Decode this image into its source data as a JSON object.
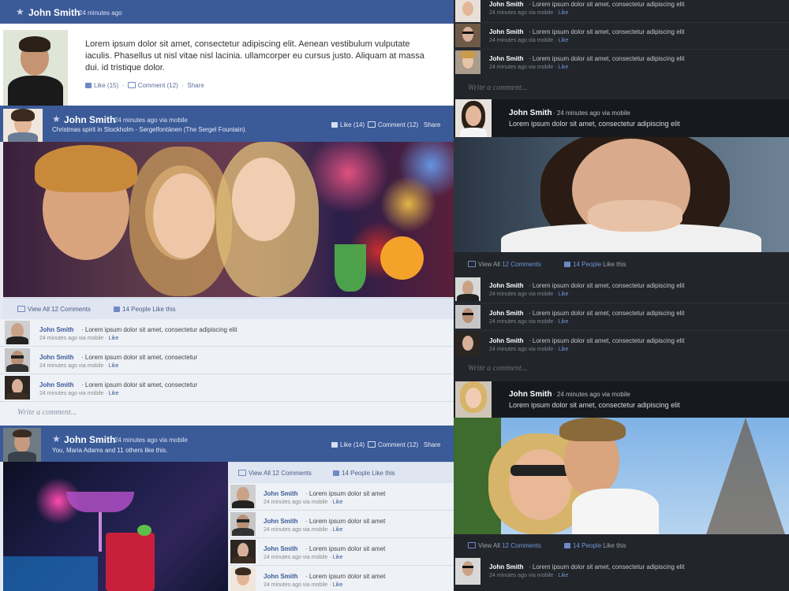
{
  "colors": {
    "facebook_blue": "#3b5a98",
    "dark_bg": "#22262b",
    "link_blue": "#6f95d9"
  },
  "icons": {
    "star": "★",
    "like": "thumbs-up-icon",
    "comment": "comment-icon"
  },
  "post1": {
    "author": "John Smith",
    "time": "24 minutes ago",
    "body_lines": [
      "Lorem ipsum dolor sit amet, consectetur adipiscing elit. Aenean vestibulum vulputate",
      "iaculis. Phasellus ut nisl vitae nisl lacinia. ullamcorper eu cursus justo. Aliquam at massa",
      "dui. id tristique dolor."
    ],
    "like": "Like (15)",
    "comment": "Comment (12)",
    "share": "Share"
  },
  "post2": {
    "author": "John Smith",
    "time": "24 minutes ago via mobile",
    "caption": "Christmas spirit in Stockholm - Sergelfontänen (The Sergel Fountain).",
    "like": "Like (14)",
    "comment": "Comment (12)",
    "share": "Share",
    "view_comments": "View All 12 Comments",
    "people_like": "14 People Like this",
    "comments": [
      {
        "name": "John Smith",
        "text": "· Lorem ipsum dolor sit amet, consectetur adipiscing elit",
        "meta": "24 minutes ago via mobile ·",
        "like": "Like"
      },
      {
        "name": "John Smith",
        "text": "· Lorem ipsum dolor sit amet, consectetur",
        "meta": "24 minutes ago via mobile ·",
        "like": "Like"
      },
      {
        "name": "John Smith",
        "text": "· Lorem ipsum dolor sit amet, consectetur",
        "meta": "24 minutes ago via mobile ·",
        "like": "Like"
      }
    ],
    "write_comment": "Write a comment..."
  },
  "post3": {
    "author": "John Smith",
    "time": "24 minutes ago via mobile",
    "caption": "You, Maria Adams and 11 others like this.",
    "like": "Like (14)",
    "comment": "Comment (12)",
    "share": "Share",
    "view_comments": "View All 12 Comments",
    "people_like": "14 People Like this",
    "comments": [
      {
        "name": "John Smith",
        "text": "· Lorem ipsum dolor sit amet",
        "meta": "24 minutes ago via mobile ·",
        "like": "Like"
      },
      {
        "name": "John Smith",
        "text": "· Lorem ipsum dolor sit amet",
        "meta": "24 minutes ago via mobile ·",
        "like": "Like"
      },
      {
        "name": "John Smith",
        "text": "· Lorem ipsum dolor sit amet",
        "meta": "24 minutes ago via mobile ·",
        "like": "Like"
      },
      {
        "name": "John Smith",
        "text": "· Lorem ipsum dolor sit amet",
        "meta": "24 minutes ago via mobile ·",
        "like": "Like"
      }
    ]
  },
  "dark_top": {
    "comments": [
      {
        "name": "John Smith",
        "text": "· Lorem ipsum dolor sit amet, consectetur adipiscing elit",
        "meta": "24 minutes ago via mobile ·",
        "like": "Like"
      },
      {
        "name": "John Smith",
        "text": "· Lorem ipsum dolor sit amet, consectetur adipiscing elit",
        "meta": "24 minutes ago via mobile ·",
        "like": "Like"
      },
      {
        "name": "John Smith",
        "text": "· Lorem ipsum dolor sit amet, consectetur adipiscing elit",
        "meta": "24 minutes ago via mobile ·",
        "like": "Like"
      }
    ],
    "write_comment": "Write a comment..."
  },
  "dark_post1": {
    "author": "John Smith",
    "time": "· 24 minutes ago via mobile",
    "text": "Lorem ipsum dolor sit amet, consectetur adipiscing elit",
    "view_prefix": "View All",
    "view_count": "12 Comments",
    "people_count": "14 People",
    "people_suffix": "Like this",
    "comments": [
      {
        "name": "John Smith",
        "text": "· Lorem ipsum dolor sit amet, consectetur adipiscing elit",
        "meta": "24 minutes ago via mobile ·",
        "like": "Like"
      },
      {
        "name": "John Smith",
        "text": "· Lorem ipsum dolor sit amet, consectetur adipiscing elit",
        "meta": "24 minutes ago via mobile ·",
        "like": "Like"
      },
      {
        "name": "John Smith",
        "text": "· Lorem ipsum dolor sit amet, consectetur adipiscing elit",
        "meta": "24 minutes ago via mobile ·",
        "like": "Like"
      }
    ],
    "write_comment": "Write a comment..."
  },
  "dark_post2": {
    "author": "John Smith",
    "time": "· 24 minutes ago via mobile",
    "text": "Lorem ipsum dolor sit amet, consectetur adipiscing elit",
    "view_prefix": "View All",
    "view_count": "12 Comments",
    "people_count": "14 People",
    "people_suffix": "Like this",
    "comments": [
      {
        "name": "John Smith",
        "text": "· Lorem ipsum dolor sit amet, consectetur adipiscing elit",
        "meta": "24 minutes ago via mobile ·",
        "like": "Like"
      }
    ]
  }
}
